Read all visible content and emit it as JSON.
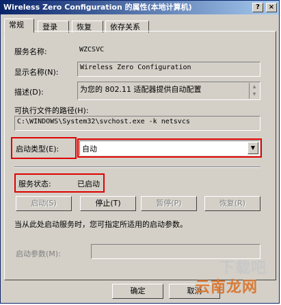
{
  "window": {
    "title": "Wireless Zero Configuration 的属性(本地计算机)",
    "help_btn": "?",
    "close_btn": "×"
  },
  "tabs": [
    "常规",
    "登录",
    "恢复",
    "依存关系"
  ],
  "general": {
    "service_name_label": "服务名称:",
    "service_name_value": "WZCSVC",
    "display_name_label": "显示名称(N):",
    "display_name_value": "Wireless Zero Configuration",
    "description_label": "描述(D):",
    "description_value": "为您的 802.11 适配器提供自动配置",
    "exe_path_label": "可执行文件的路径(H):",
    "exe_path_value": "C:\\WINDOWS\\System32\\svchost.exe -k netsvcs",
    "startup_type_label": "启动类型(E):",
    "startup_type_value": "自动",
    "service_status_label": "服务状态:",
    "service_status_value": "已启动",
    "start_button": "启动(S)",
    "stop_button": "停止(T)",
    "pause_button": "暂停(P)",
    "resume_button": "恢复(R)",
    "hint_text": "当从此处启动服务时，您可指定所适用的启动参数。",
    "start_params_label": "启动参数(M):"
  },
  "footer": {
    "ok_button": "确定",
    "cancel_button": "取消"
  },
  "watermark": {
    "top": "下载吧",
    "bottom": "云南龙网"
  },
  "colors": {
    "highlight_box": "#e00000",
    "titlebar": "#0a246a",
    "face": "#d4d0c8"
  }
}
